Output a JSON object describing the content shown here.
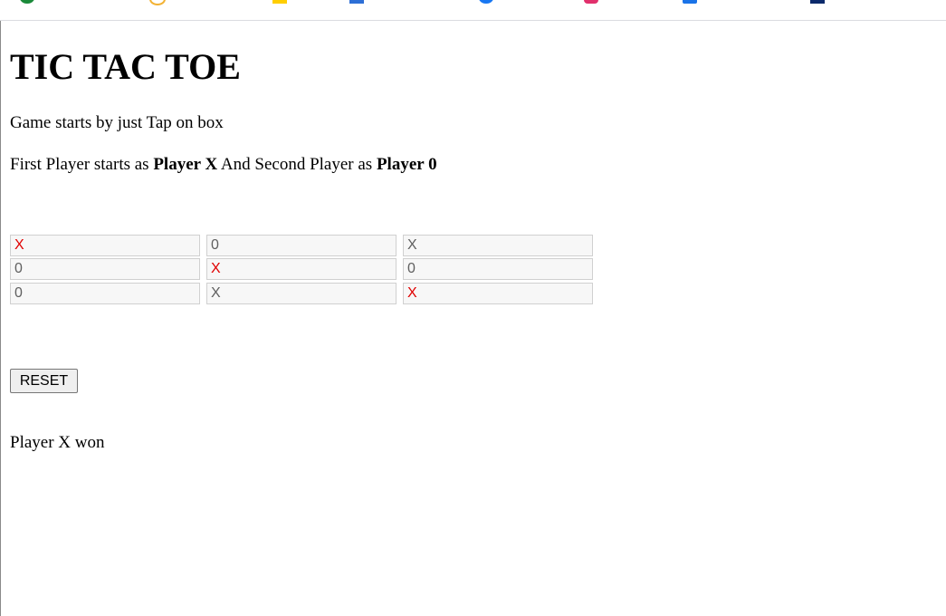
{
  "page": {
    "title": "TIC TAC TOE",
    "instructions": "Game starts by just Tap on box",
    "players_line": {
      "prefix": "First Player starts as ",
      "player1": "Player X",
      "middle": " And Second Player as ",
      "player2": "Player 0"
    }
  },
  "board": {
    "cells": [
      {
        "value": "X",
        "highlight": true
      },
      {
        "value": "0",
        "highlight": false
      },
      {
        "value": "X",
        "highlight": false
      },
      {
        "value": "0",
        "highlight": false
      },
      {
        "value": "X",
        "highlight": true
      },
      {
        "value": "0",
        "highlight": false
      },
      {
        "value": "0",
        "highlight": false
      },
      {
        "value": "X",
        "highlight": false
      },
      {
        "value": "X",
        "highlight": true
      }
    ],
    "win_color": "#e00000",
    "normal_color": "#5f5f5f"
  },
  "controls": {
    "reset_label": "RESET"
  },
  "status": {
    "result": "Player X won"
  }
}
